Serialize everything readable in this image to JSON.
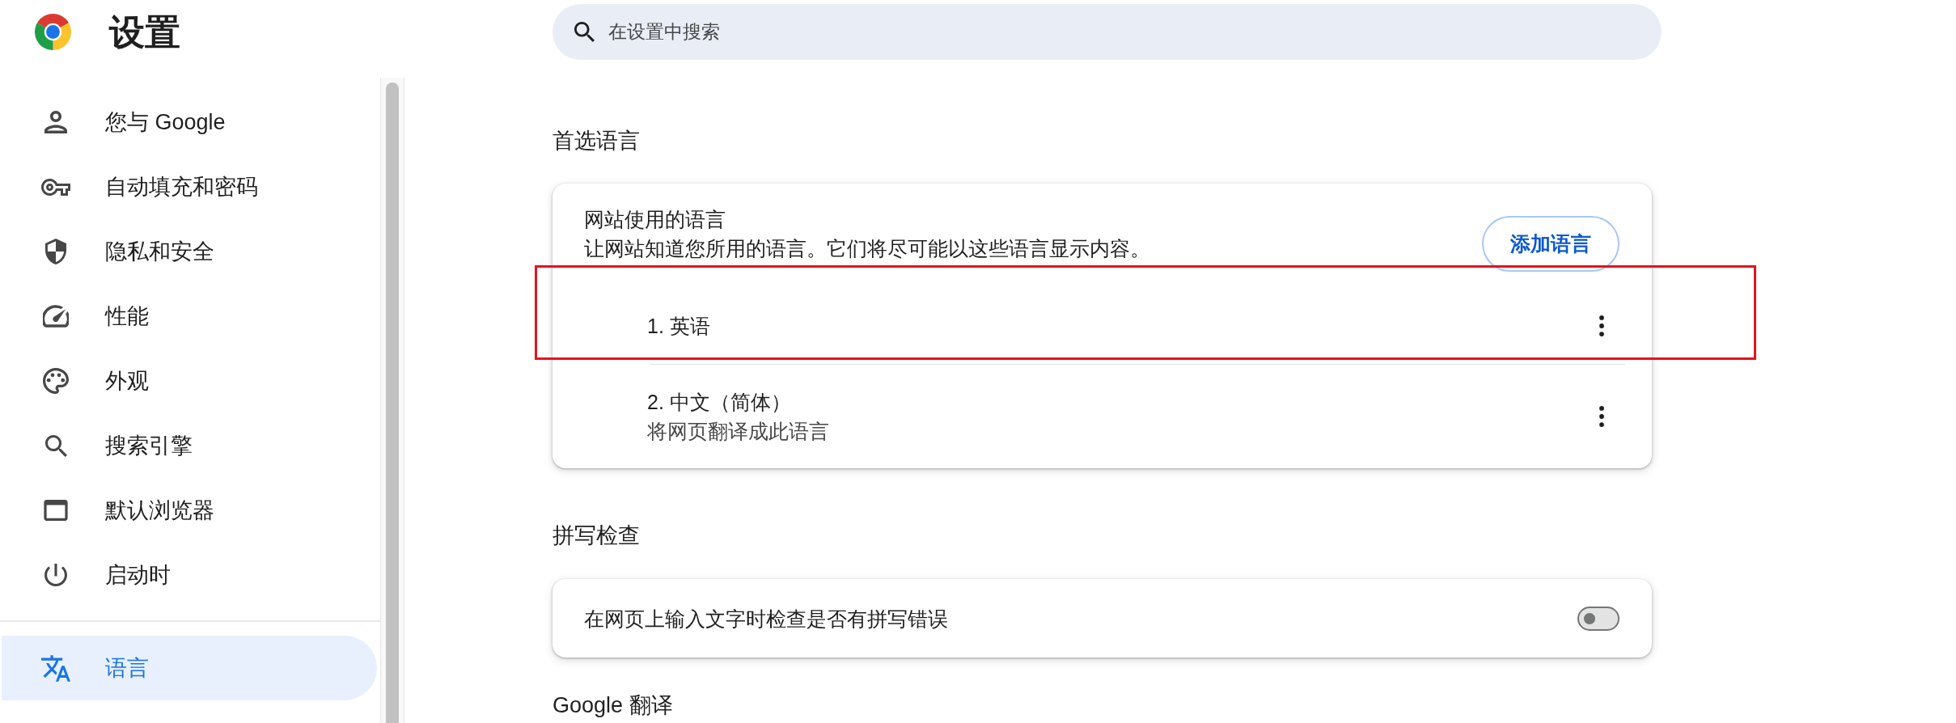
{
  "header": {
    "title": "设置"
  },
  "search": {
    "placeholder": "在设置中搜索"
  },
  "sidebar": {
    "sections": [
      {
        "items": [
          {
            "label": "您与 Google",
            "selected": false
          },
          {
            "label": "自动填充和密码",
            "selected": false
          },
          {
            "label": "隐私和安全",
            "selected": false
          },
          {
            "label": "性能",
            "selected": false
          },
          {
            "label": "外观",
            "selected": false
          },
          {
            "label": "搜索引擎",
            "selected": false
          },
          {
            "label": "默认浏览器",
            "selected": false
          },
          {
            "label": "启动时",
            "selected": false
          }
        ]
      },
      {
        "items": [
          {
            "label": "语言",
            "selected": true
          }
        ]
      }
    ]
  },
  "preferred_languages": {
    "heading": "首选语言",
    "title": "网站使用的语言",
    "description": "让网站知道您所用的语言。它们将尽可能以这些语言显示内容。",
    "add_button": "添加语言",
    "languages": [
      {
        "label": "1. 英语",
        "highlighted": true
      },
      {
        "label": "2. 中文（简体）",
        "subtitle": "将网页翻译成此语言",
        "highlighted": false
      }
    ]
  },
  "spell_check": {
    "heading": "拼写检查",
    "label": "在网页上输入文字时检查是否有拼写错误",
    "on": false
  },
  "google_translate": {
    "heading": "Google 翻译"
  }
}
